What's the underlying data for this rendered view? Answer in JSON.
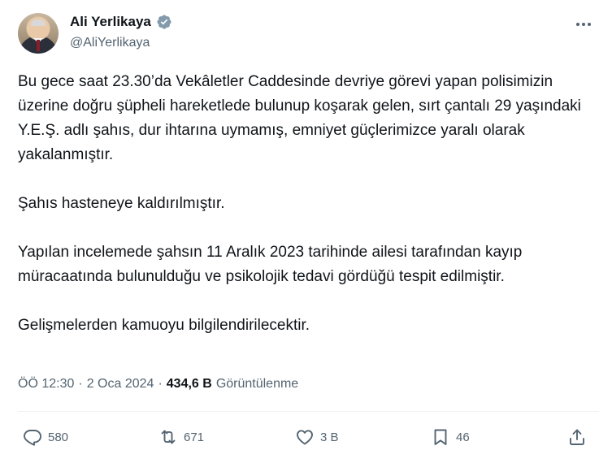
{
  "author": {
    "name": "Ali Yerlikaya",
    "handle": "@AliYerlikaya",
    "verified_color": "#829aab"
  },
  "tweet": {
    "paragraphs": [
      "Bu gece saat 23.30’da Vekâletler Caddesinde devriye görevi yapan polisimizin üzerine doğru şüpheli hareketlede bulunup koşarak gelen, sırt çantalı 29 yaşındaki Y.E.Ş. adlı şahıs, dur ihtarına uymamış, emniyet güçlerimizce yaralı olarak yakalanmıştır.",
      "Şahıs hasteneye kaldırılmıştır.",
      "Yapılan incelemede şahsın 11 Aralık 2023 tarihinde ailesi tarafından kayıp    müracaatında bulunulduğu ve psikolojik tedavi gördüğü tespit edilmiştir.",
      "Gelişmelerden kamuoyu bilgilendirilecektir."
    ]
  },
  "meta": {
    "time": "ÖÖ 12:30",
    "separator": "·",
    "date": "2 Oca 2024",
    "views_count": "434,6 B",
    "views_label": "Görüntülenme"
  },
  "actions": {
    "reply_count": "580",
    "retweet_count": "671",
    "like_count": "3 B",
    "bookmark_count": "46"
  },
  "icons": {
    "verified": "verified-badge-icon",
    "more": "more-icon",
    "reply": "reply-icon",
    "retweet": "retweet-icon",
    "like": "heart-icon",
    "bookmark": "bookmark-icon",
    "share": "share-icon"
  }
}
